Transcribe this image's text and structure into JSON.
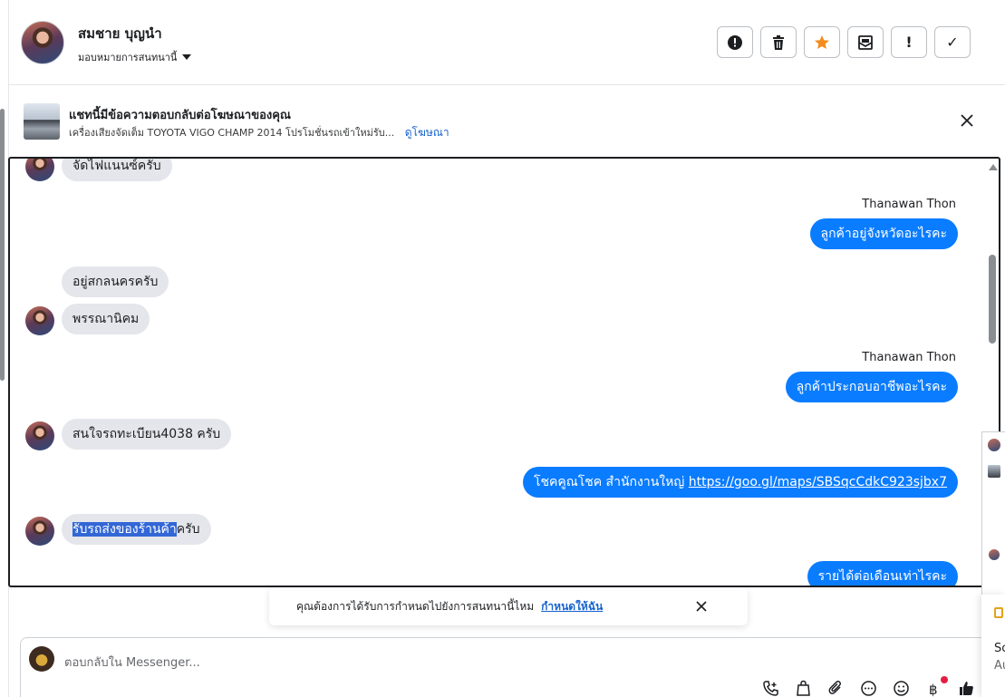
{
  "header": {
    "contact_name": "สมชาย บุญนำ",
    "assign_label": "มอบหมายการสนทนานี้",
    "toolbar": [
      "!",
      "✓"
    ]
  },
  "ad_banner": {
    "title": "แชทนี้มีข้อความตอบกลับต่อโฆษณาของคุณ",
    "description": "เครื่องเสียงจัดเต็ม TOYOTA VIGO CHAMP 2014 โปรโมชั่นรถเข้าใหม่รับ...",
    "link": "ดูโฆษณา"
  },
  "messages": [
    {
      "dir": "in",
      "text": "จัดไฟแนนซ์ครับ"
    },
    {
      "dir": "out",
      "sender": "Thanawan Thon",
      "text": "ลูกค้าอยู่จังหวัดอะไรคะ"
    },
    {
      "dir": "in",
      "text": "อยู่สกลนครครับ"
    },
    {
      "dir": "in",
      "text": "พรรณานิคม"
    },
    {
      "dir": "out",
      "sender": "Thanawan Thon",
      "text": "ลูกค้าประกอบอาชีพอะไรคะ"
    },
    {
      "dir": "in",
      "text": "สนใจรถทะเบียน4038 ครับ"
    },
    {
      "dir": "out",
      "text_prefix": "โชคคูณโชค สำนักงานใหญ่ ",
      "link": "https://goo.gl/maps/SBSqcCdkC923sjbx7"
    },
    {
      "dir": "in",
      "highlighted": "รับรถส่งของร้านค้า",
      "text_suffix": "ครับ"
    },
    {
      "dir": "out",
      "text": "รายได้ต่อเดือนเท่าไรคะ"
    }
  ],
  "reminder": {
    "text": "คุณต้องการได้รับการกำหนดไปยังการสนทนานี้ไหม",
    "link": "กำหนดให้ฉัน"
  },
  "composer": {
    "placeholder": "ตอบกลับใน Messenger..."
  },
  "edge_card": {
    "line1": "Sc",
    "line2": "Au"
  },
  "colors": {
    "outgoing_bubble": "#0a7cff",
    "incoming_bubble": "#e4e6eb",
    "link": "#1763cf",
    "star": "#f28c1e",
    "notification_dot": "#e41e3f"
  }
}
